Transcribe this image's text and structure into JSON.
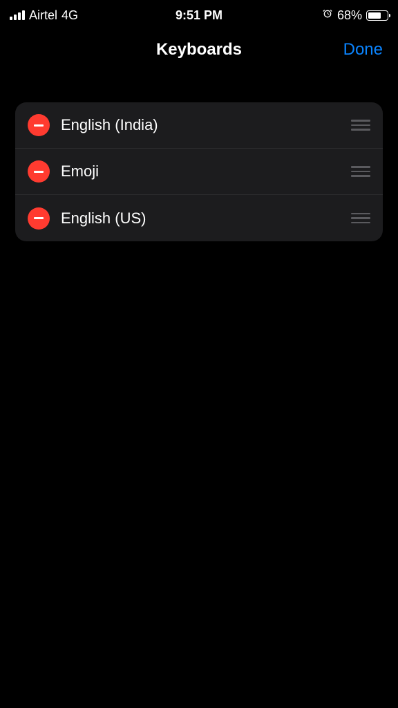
{
  "status": {
    "carrier": "Airtel",
    "network": "4G",
    "time": "9:51 PM",
    "battery_pct": "68%"
  },
  "nav": {
    "title": "Keyboards",
    "done_label": "Done"
  },
  "keyboards": [
    {
      "label": "English (India)"
    },
    {
      "label": "Emoji"
    },
    {
      "label": "English (US)"
    }
  ]
}
